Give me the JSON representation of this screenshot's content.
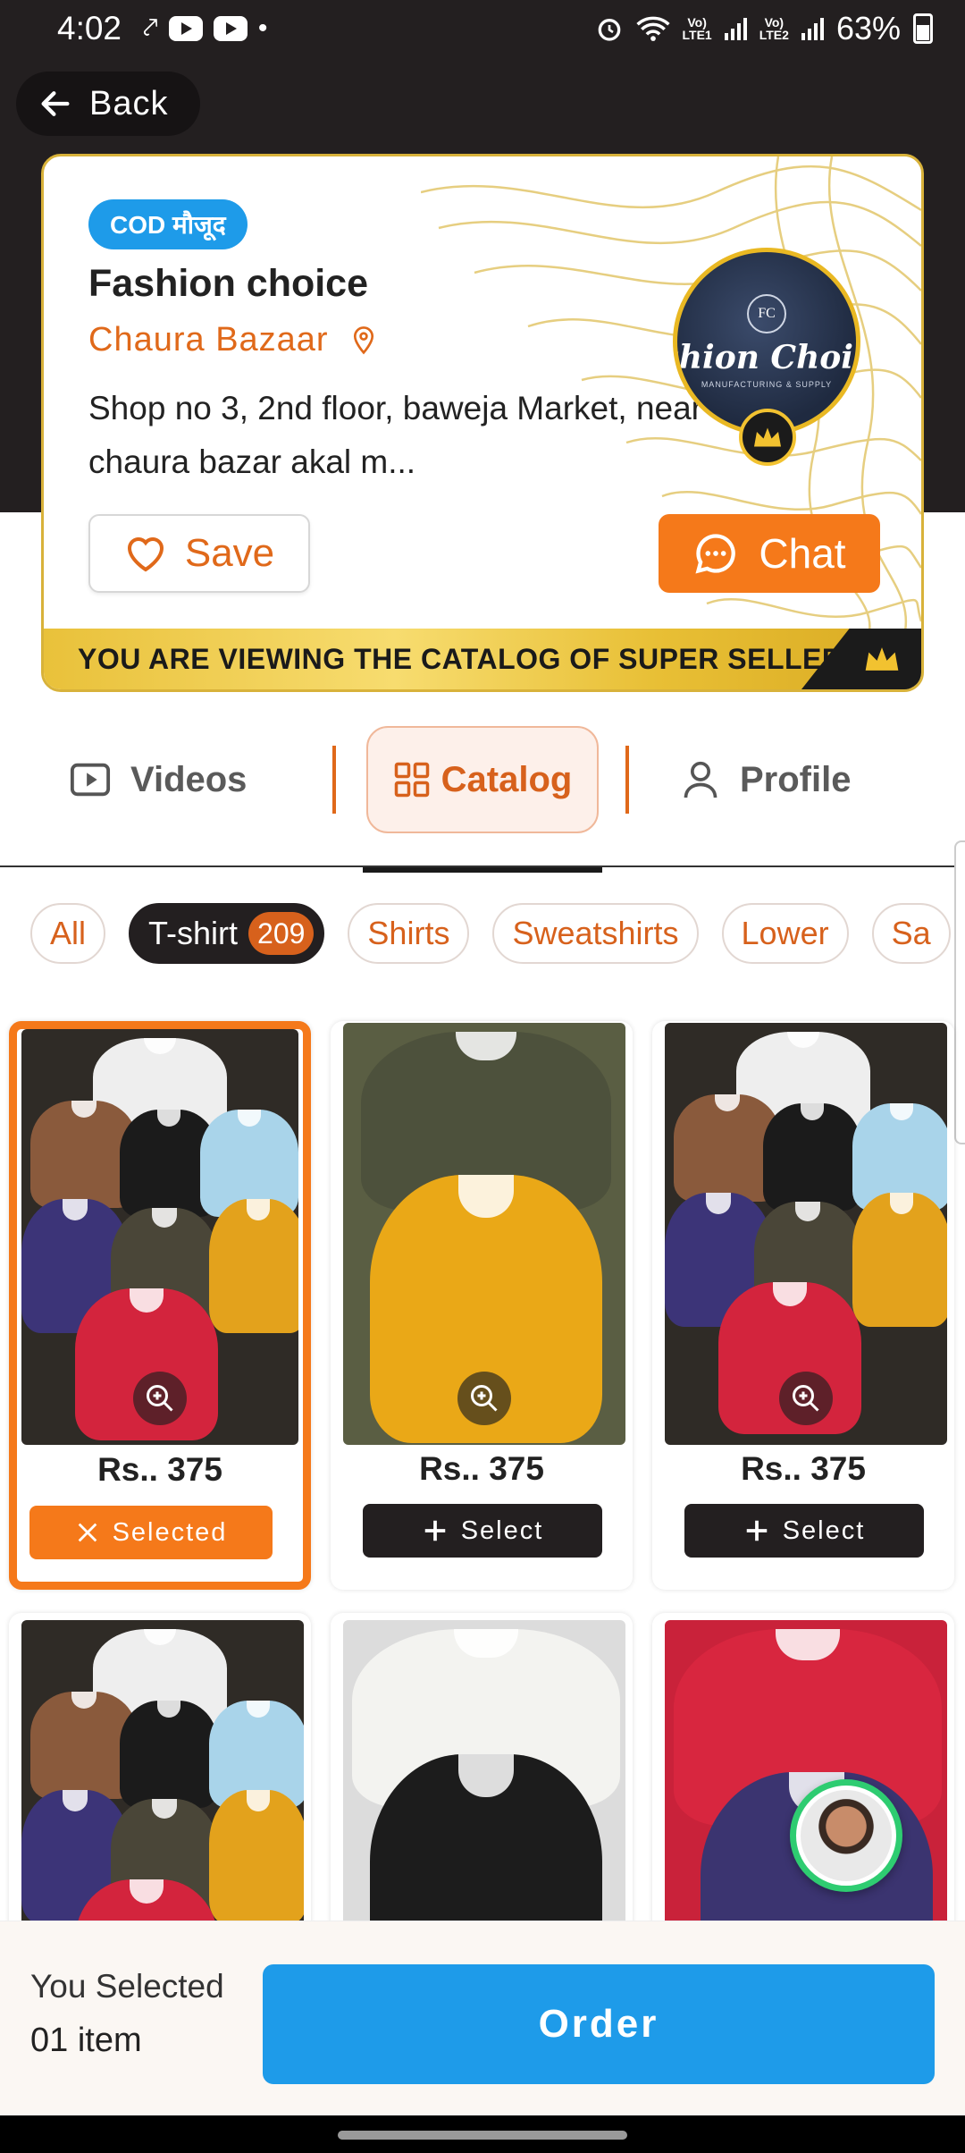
{
  "status_bar": {
    "time": "4:02",
    "battery": "63%"
  },
  "header": {
    "back_label": "Back"
  },
  "store": {
    "cod_badge": "COD मौजूद",
    "name": "Fashion choice",
    "location": "Chaura Bazaar",
    "address": "Shop no 3, 2nd floor, baweja Market, near chaura bazar akal m...",
    "logo_text": "ashion Choice",
    "logo_initials": "FC",
    "logo_subtext": "MANUFACTURING & SUPPLY",
    "save_label": "Save",
    "chat_label": "Chat",
    "super_seller_banner": "YOU ARE VIEWING THE CATALOG OF SUPER SELLER"
  },
  "tabs": [
    {
      "label": "Videos",
      "icon": "play-icon",
      "active": false
    },
    {
      "label": "Catalog",
      "icon": "grid-icon",
      "active": true
    },
    {
      "label": "Profile",
      "icon": "person-icon",
      "active": false
    }
  ],
  "chips": [
    {
      "label": "All"
    },
    {
      "label": "T-shirt",
      "count": "209",
      "active": true
    },
    {
      "label": "Shirts"
    },
    {
      "label": "Sweatshirts"
    },
    {
      "label": "Lower"
    },
    {
      "label": "Sa"
    }
  ],
  "products": [
    {
      "price": "Rs.. 375",
      "button": "Selected",
      "selected": true
    },
    {
      "price": "Rs.. 375",
      "button": "Select",
      "selected": false
    },
    {
      "price": "Rs.. 375",
      "button": "Select",
      "selected": false
    }
  ],
  "bottom": {
    "selected_label": "You Selected",
    "selected_count": "01 item",
    "order_label": "Order"
  },
  "colors": {
    "accent_orange": "#f5791a",
    "brand_blue": "#1e9be9",
    "dark": "#231f20",
    "gold": "#d8b23a"
  }
}
